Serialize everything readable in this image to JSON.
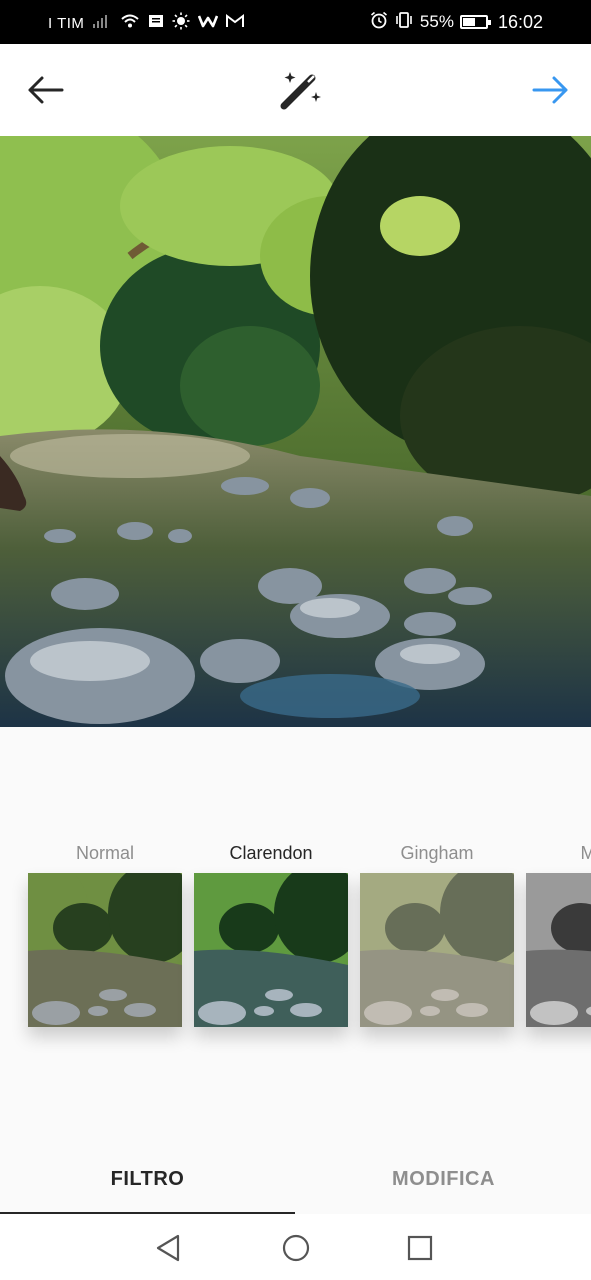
{
  "status_bar": {
    "carrier": "I TIM",
    "battery_percent": "55%",
    "battery_level": 0.55,
    "time": "16:02",
    "icons": [
      "signal-icon",
      "wifi-icon",
      "message-icon",
      "brightness-icon",
      "w-app-icon",
      "gmail-icon",
      "alarm-icon",
      "vibrate-icon",
      "battery-icon"
    ]
  },
  "toolbar": {
    "back_icon": "arrow-left-icon",
    "magic_icon": "magic-wand-icon",
    "next_icon": "arrow-right-icon",
    "next_color": "#3897f0"
  },
  "filters": {
    "items": [
      {
        "name": "Normal",
        "selected": false,
        "style": "normal"
      },
      {
        "name": "Clarendon",
        "selected": true,
        "style": "clarendon"
      },
      {
        "name": "Gingham",
        "selected": false,
        "style": "gingham"
      },
      {
        "name": "Moon",
        "selected": false,
        "style": "moon"
      }
    ]
  },
  "tabs": {
    "filter_label": "FILTRO",
    "edit_label": "MODIFICA",
    "active": "FILTRO"
  },
  "navigation": {
    "icons": [
      "nav-back-icon",
      "nav-home-icon",
      "nav-recents-icon"
    ]
  }
}
